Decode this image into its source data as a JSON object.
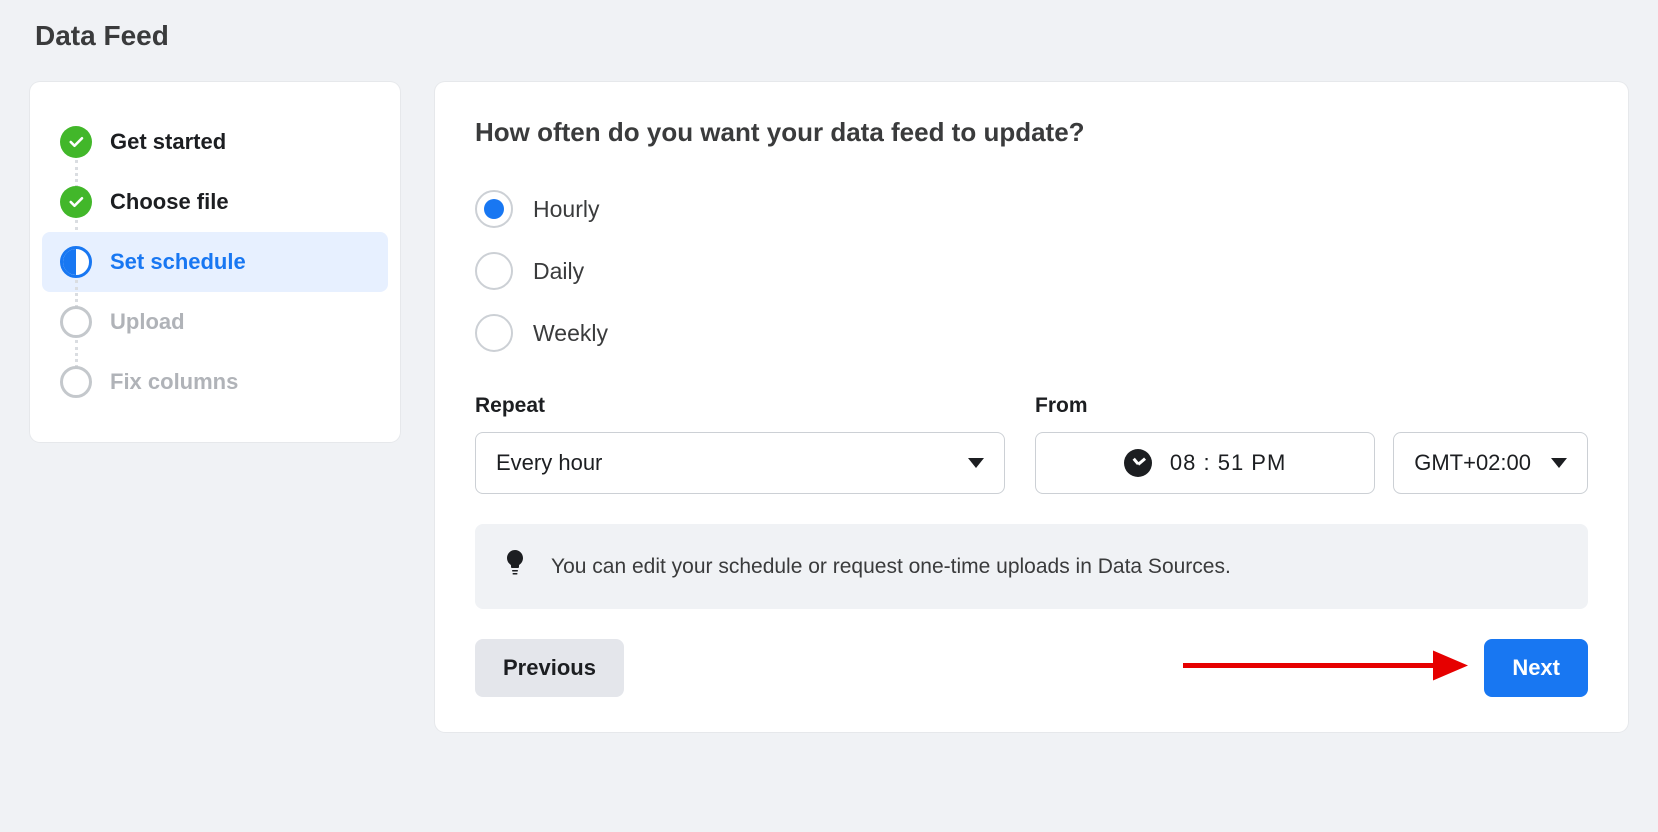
{
  "page_title": "Data Feed",
  "sidebar": {
    "steps": [
      {
        "label": "Get started",
        "state": "done"
      },
      {
        "label": "Choose file",
        "state": "done"
      },
      {
        "label": "Set schedule",
        "state": "current"
      },
      {
        "label": "Upload",
        "state": "pending"
      },
      {
        "label": "Fix columns",
        "state": "pending"
      }
    ]
  },
  "main": {
    "question": "How often do you want your data feed to update?",
    "frequency_options": [
      {
        "label": "Hourly",
        "selected": true
      },
      {
        "label": "Daily",
        "selected": false
      },
      {
        "label": "Weekly",
        "selected": false
      }
    ],
    "repeat_label": "Repeat",
    "repeat_value": "Every hour",
    "from_label": "From",
    "from_time": "08 : 51 PM",
    "from_timezone": "GMT+02:00",
    "info_text": "You can edit your schedule or request one-time uploads in Data Sources.",
    "buttons": {
      "previous": "Previous",
      "next": "Next"
    }
  }
}
